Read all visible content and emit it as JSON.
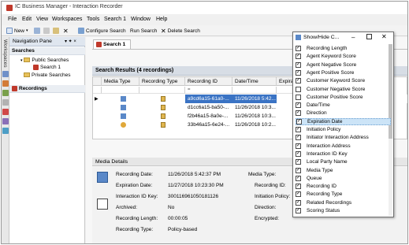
{
  "window": {
    "title": "IC Business Manager - Interaction Recorder"
  },
  "menu": [
    "File",
    "Edit",
    "View",
    "Workspaces",
    "Tools",
    "Search 1",
    "Window",
    "Help"
  ],
  "toolbar": {
    "new_label": "New",
    "configure_search": "Configure Search",
    "run_search": "Run Search",
    "delete_search": "Delete Search"
  },
  "sidebar": {
    "workspaces_label": "Workspaces"
  },
  "nav": {
    "title": "Navigation Pane",
    "pin_glyph": "▾ ✦ ×",
    "searches_header": "Searches",
    "public_searches": "Public Searches",
    "search1": "Search 1",
    "private_searches": "Private Searches",
    "recordings_header": "Recordings"
  },
  "tab": {
    "label": "Search 1"
  },
  "results": {
    "header": "Search Results (4 recordings)",
    "columns": [
      "Media Type",
      "Recording Type",
      "Recording ID",
      "Date/Time",
      "Expira"
    ],
    "filter_eq": "=",
    "rows": [
      {
        "id": "a9cd6a15-61a0-...",
        "date": "11/26/2018 5:42..."
      },
      {
        "id": "d1cc6a15-ba50-...",
        "date": "11/26/2018 10:3..."
      },
      {
        "id": "f2b46a15-8a0e-...",
        "date": "11/26/2018 10:3..."
      },
      {
        "id": "33b46a15-6e24-...",
        "date": "11/26/2018 10:2..."
      }
    ]
  },
  "details": {
    "header": "Media Details",
    "recording_date_label": "Recording Date:",
    "recording_date": "11/26/2018 5:42:37 PM",
    "expiration_date_label": "Expiration Date:",
    "expiration_date": "11/27/2018 10:23:30 PM",
    "interaction_id_label": "Interaction ID Key:",
    "interaction_id": "300116961050181126",
    "archived_label": "Archived:",
    "archived": "No",
    "length_label": "Recording Length:",
    "length": "00:00:05",
    "rec_type_label": "Recording Type:",
    "rec_type": "Policy-based",
    "media_type_label": "Media Type:",
    "recording_id_label": "Recording ID:",
    "init_policy_label": "Initiation Policy:",
    "direction_label": "Direction:",
    "encrypted_label": "Encrypted:"
  },
  "dialog": {
    "title": "Show/Hide C...",
    "options": [
      {
        "label": "Recording Length",
        "checked": true
      },
      {
        "label": "Agent Keyword Score",
        "checked": true
      },
      {
        "label": "Agent Negative Score",
        "checked": true
      },
      {
        "label": "Agent Positive Score",
        "checked": true
      },
      {
        "label": "Customer Keyword Score",
        "checked": true
      },
      {
        "label": "Customer Negative Score",
        "checked": false
      },
      {
        "label": "Customer Positive Score",
        "checked": false
      },
      {
        "label": "Date/Time",
        "checked": true
      },
      {
        "label": "Direction",
        "checked": true
      },
      {
        "label": "Expiration Date",
        "checked": true
      },
      {
        "label": "Initiation Policy",
        "checked": true
      },
      {
        "label": "Initiator Interaction Address",
        "checked": true
      },
      {
        "label": "Interaction Address",
        "checked": true
      },
      {
        "label": "Interaction ID Key",
        "checked": true
      },
      {
        "label": "Local Party Name",
        "checked": true
      },
      {
        "label": "Media Type",
        "checked": true
      },
      {
        "label": "Queue",
        "checked": true
      },
      {
        "label": "Recording ID",
        "checked": true
      },
      {
        "label": "Recording Type",
        "checked": true
      },
      {
        "label": "Related Recordings",
        "checked": true
      },
      {
        "label": "Scoring Status",
        "checked": true
      }
    ]
  }
}
